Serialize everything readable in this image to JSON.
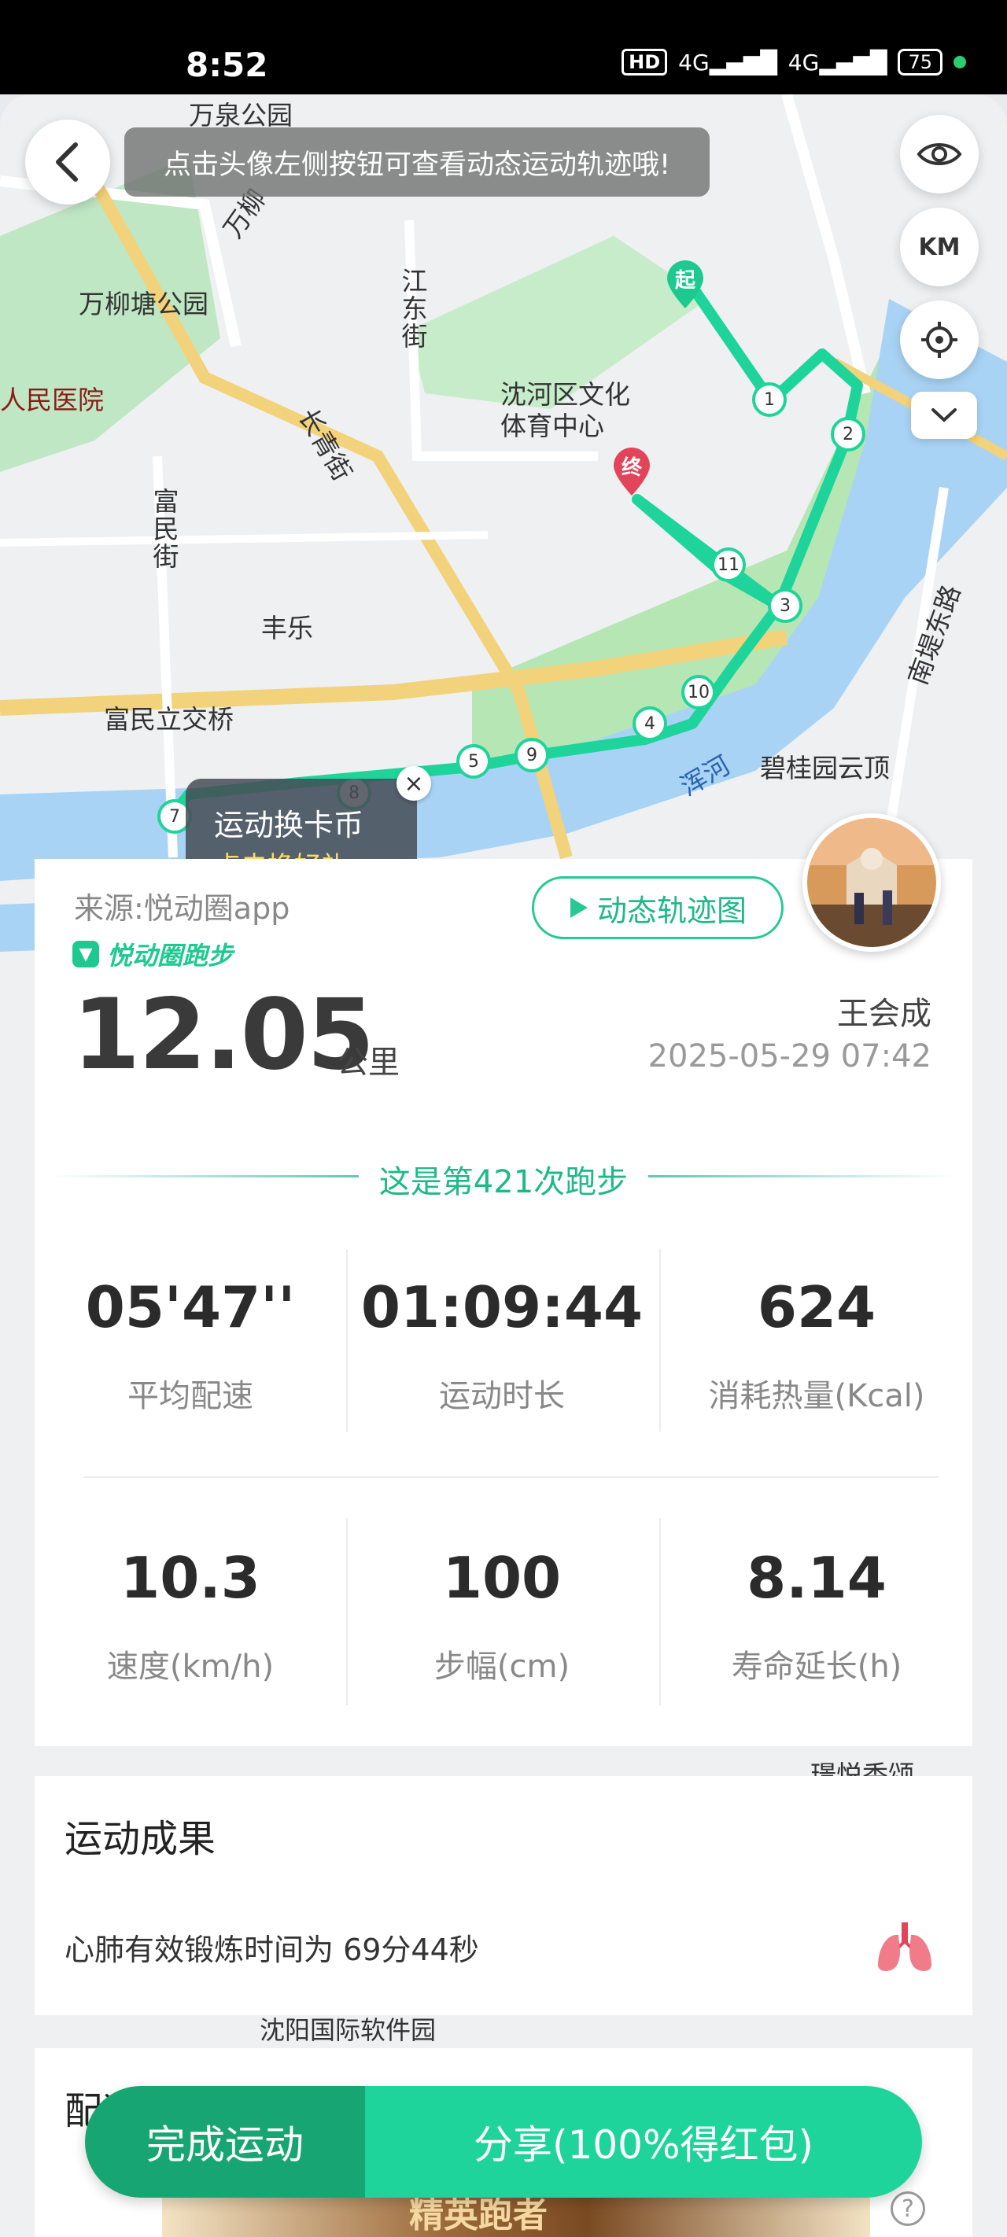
{
  "status_bar": {
    "time": "8:52",
    "hd": "HD",
    "network1": "4G",
    "network2": "4G",
    "battery": "75"
  },
  "map": {
    "labels": {
      "wanquan_park": "万泉公园",
      "wanliu_park": "万柳塘公园",
      "people_hospital": "人民医院",
      "culture_center": "沈河区文化\n体育中心",
      "jiangdong_st": "江东街",
      "changqing_st": "长青街",
      "fumin_st": "富民街",
      "fengle": "丰乐",
      "fumin_bridge": "富民立交桥",
      "hunhe": "浑河",
      "biguiyuan": "碧桂园云顶",
      "nandi_east_rd": "南堤东路",
      "wanliu_rd": "万柳",
      "software_park": "沈阳国际软件园",
      "jingyue": "璟悦香颂"
    },
    "route_markers": [
      "1",
      "2",
      "3",
      "4",
      "5",
      "7",
      "8",
      "9",
      "10",
      "11"
    ],
    "start_label": "起",
    "end_label": "终"
  },
  "tip_banner": "点击头像左侧按钮可查看动态运动轨迹哦!",
  "controls": {
    "km_label": "KM"
  },
  "card_popup": {
    "title": "运动换卡币",
    "subtitle": "点击换好礼"
  },
  "summary": {
    "source": "来源:悦动圈app",
    "brand": "悦动圈跑步",
    "dynamic_track_btn": "动态轨迹图",
    "distance": "12.05",
    "distance_unit": "公里",
    "user_name": "王会成",
    "datetime": "2025-05-29 07:42",
    "run_count": "这是第421次跑步",
    "stats": [
      {
        "value": "05'47''",
        "label": "平均配速"
      },
      {
        "value": "01:09:44",
        "label": "运动时长"
      },
      {
        "value": "624",
        "label": "消耗热量(Kcal)"
      },
      {
        "value": "10.3",
        "label": "速度(km/h)"
      },
      {
        "value": "100",
        "label": "步幅(cm)"
      },
      {
        "value": "8.14",
        "label": "寿命延长(h)"
      }
    ]
  },
  "result": {
    "title": "运动成果",
    "desc": "心肺有效锻炼时间为 69分44秒"
  },
  "partial_card": {
    "title": "配速",
    "elite": "精英跑者"
  },
  "actions": {
    "finish": "完成运动",
    "share": "分享(100%得红包)"
  }
}
